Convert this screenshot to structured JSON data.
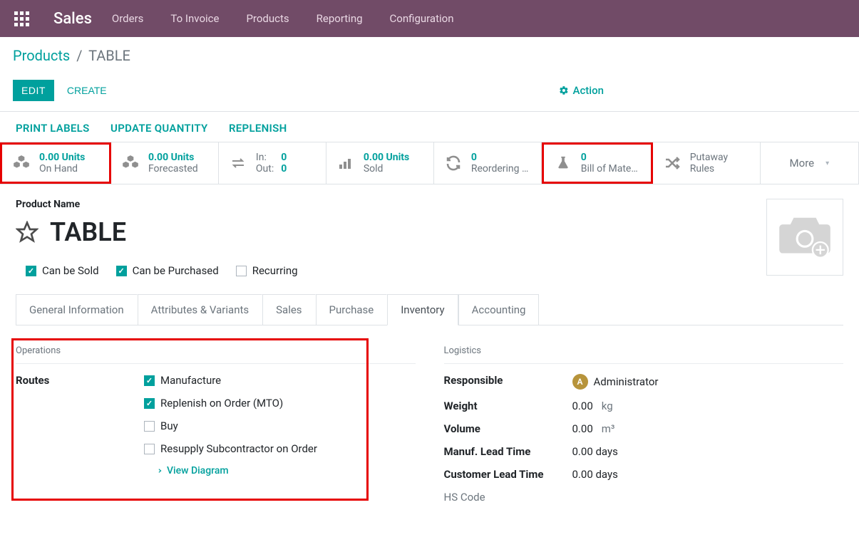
{
  "topbar": {
    "app_title": "Sales",
    "menu": [
      "Orders",
      "To Invoice",
      "Products",
      "Reporting",
      "Configuration"
    ]
  },
  "breadcrumb": {
    "root": "Products",
    "sep": "/",
    "current": "TABLE"
  },
  "buttons": {
    "edit": "EDIT",
    "create": "CREATE",
    "action": "Action"
  },
  "actionbar2": [
    "PRINT LABELS",
    "UPDATE QUANTITY",
    "REPLENISH"
  ],
  "stats": {
    "onhand": {
      "value": "0.00 Units",
      "label": "On Hand"
    },
    "forecast": {
      "value": "0.00 Units",
      "label": "Forecasted"
    },
    "io_in_label": "In:",
    "io_in_val": "0",
    "io_out_label": "Out:",
    "io_out_val": "0",
    "sold": {
      "value": "0.00 Units",
      "label": "Sold"
    },
    "reorder": {
      "value": "0",
      "label": "Reordering …"
    },
    "bom": {
      "value": "0",
      "label": "Bill of Mate…"
    },
    "putaway": {
      "value": "Putaway",
      "label": "Rules"
    },
    "more": "More"
  },
  "form": {
    "pn_label": "Product Name",
    "title": "TABLE",
    "flags": {
      "sold": "Can be Sold",
      "purchased": "Can be Purchased",
      "recurring": "Recurring"
    }
  },
  "tabs": [
    "General Information",
    "Attributes & Variants",
    "Sales",
    "Purchase",
    "Inventory",
    "Accounting"
  ],
  "active_tab": "Inventory",
  "operations": {
    "title": "Operations",
    "routes_label": "Routes",
    "routes": {
      "manufacture": "Manufacture",
      "mto": "Replenish on Order (MTO)",
      "buy": "Buy",
      "resupply": "Resupply Subcontractor on Order"
    },
    "view_diagram": "View Diagram"
  },
  "logistics": {
    "title": "Logistics",
    "responsible_label": "Responsible",
    "responsible_val": "Administrator",
    "avatar_letter": "A",
    "weight_label": "Weight",
    "weight_val": "0.00",
    "weight_unit": "kg",
    "volume_label": "Volume",
    "volume_val": "0.00",
    "volume_unit": "m³",
    "mlt_label": "Manuf. Lead Time",
    "mlt_val": "0.00 days",
    "clt_label": "Customer Lead Time",
    "clt_val": "0.00 days",
    "hs_label": "HS Code"
  }
}
